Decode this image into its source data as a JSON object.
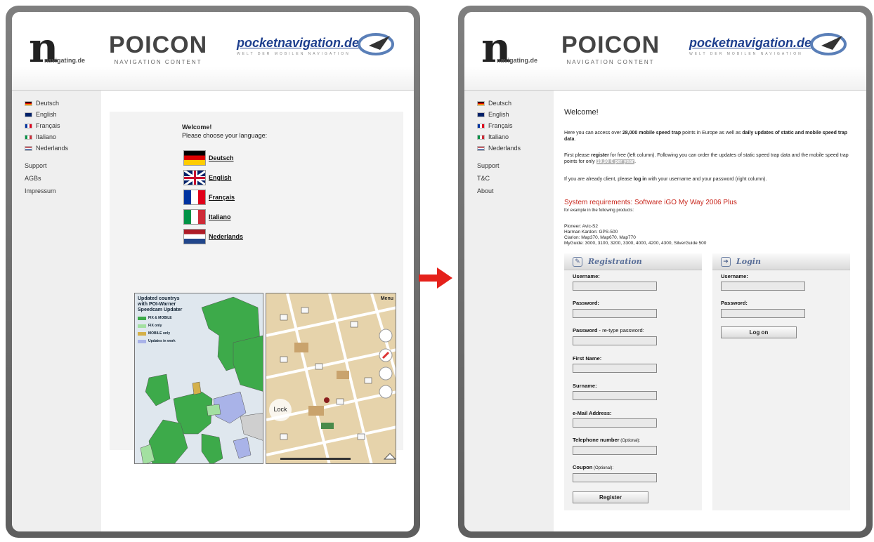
{
  "left_page": {
    "logos": {
      "navigating": {
        "big": "n",
        "small": "navigating.de"
      },
      "poicon": {
        "title": "POICON",
        "subtitle": "NAVIGATION CONTENT"
      },
      "pocketnavigation": {
        "title": "pocketnavigation.de",
        "subtitle": "WELT DER MOBILEN NAVIGATION"
      }
    },
    "sidebar": {
      "languages": [
        {
          "label": "Deutsch",
          "flag": "flag-de"
        },
        {
          "label": "English",
          "flag": "flag-uk"
        },
        {
          "label": "Français",
          "flag": "flag-fr"
        },
        {
          "label": "Italiano",
          "flag": "flag-it"
        },
        {
          "label": "Nederlands",
          "flag": "flag-nl"
        }
      ],
      "menu": [
        "Support",
        "AGBs",
        "Impressum"
      ]
    },
    "welcome": {
      "title": "Welcome!",
      "subtitle": "Please choose your language:"
    },
    "big_flags": [
      {
        "label": "Deutsch",
        "flag": "flag-de"
      },
      {
        "label": "English",
        "flag": "flag-uk"
      },
      {
        "label": "Français",
        "flag": "flag-fr"
      },
      {
        "label": "Italiano",
        "flag": "flag-it"
      },
      {
        "label": "Nederlands",
        "flag": "flag-nl"
      }
    ],
    "map_legend": {
      "title_lines": [
        "Updated countrys",
        "with POI-Warner",
        "Speedcam Updater"
      ],
      "items": [
        {
          "label": "FIX & MOBILE",
          "color": "#3daa4a"
        },
        {
          "label": "FIX only",
          "color": "#a3e0a1"
        },
        {
          "label": "MOBILE only",
          "color": "#d4b04a"
        },
        {
          "label": "Updates in work",
          "color": "#a9b3e8"
        }
      ]
    },
    "city_map": {
      "menu_label": "Menu",
      "lock_label": "Lock"
    }
  },
  "right_page": {
    "sidebar": {
      "languages": [
        {
          "label": "Deutsch",
          "flag": "flag-de"
        },
        {
          "label": "English",
          "flag": "flag-uk"
        },
        {
          "label": "Français",
          "flag": "flag-fr"
        },
        {
          "label": "Italiano",
          "flag": "flag-it"
        },
        {
          "label": "Nederlands",
          "flag": "flag-nl"
        }
      ],
      "menu": [
        "Support",
        "T&C",
        "About"
      ]
    },
    "welcome_title": "Welcome!",
    "intro": {
      "p1_a": "Here you can access over ",
      "p1_b": "28,000 mobile speed trap",
      "p1_c": " points in Europe as well as ",
      "p1_d": "daily updates of static and mobile speed trap data",
      "p1_e": ".",
      "p2_a": "First please ",
      "p2_b": "register",
      "p2_c": " for free (left column). Following you can order the updates of static speed trap data and the mobile speed trap points for only ",
      "p2_price": "19,90 € per year",
      "p2_d": ".",
      "p3_a": "If you are already client, please ",
      "p3_b": "log in",
      "p3_c": " with your username and your password (right column)."
    },
    "system_requirements": "System requirements: Software iGO My Way 2006 Plus",
    "example_text": "for example in the following products:",
    "products": [
      "Pioneer: Avic-S2",
      "Harman Kardon: GPS-500",
      "Clarion: Map370, Map670, Map770",
      "MyGuide: 3000, 3100, 3200, 3300, 4000, 4200, 4300, SilverGuide 500"
    ],
    "registration": {
      "title": "Registration",
      "fields": [
        {
          "label": "Username:",
          "extra": ""
        },
        {
          "label": "Password:",
          "extra": ""
        },
        {
          "label": "Password",
          "extra": " - re-type password:"
        },
        {
          "label": "First Name:",
          "extra": ""
        },
        {
          "label": "Surname:",
          "extra": ""
        },
        {
          "label": "e-Mail Address:",
          "extra": ""
        },
        {
          "label": "Telephone number",
          "extra": " (Optional):"
        },
        {
          "label": "Coupon",
          "extra": " (Optional):"
        }
      ],
      "button": "Register"
    },
    "login": {
      "title": "Login",
      "fields": [
        {
          "label": "Username:"
        },
        {
          "label": "Password:"
        }
      ],
      "button": "Log on"
    }
  },
  "colors": {
    "arrow": "#e5211b",
    "frame": "#6e6e6e",
    "sidebar": "#efefef",
    "accent_red": "#c8261c",
    "panel_title": "#5a6f98"
  }
}
